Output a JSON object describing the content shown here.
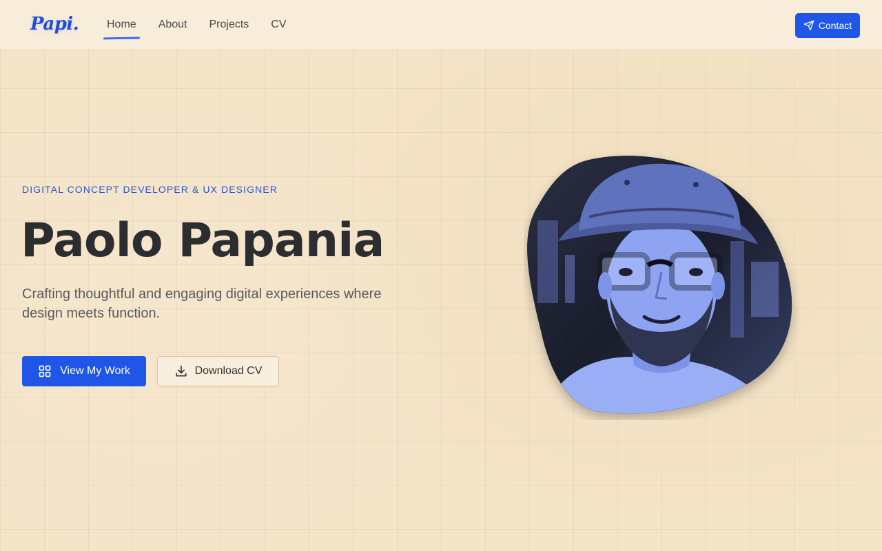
{
  "header": {
    "logo": "Papi.",
    "nav": [
      {
        "label": "Home"
      },
      {
        "label": "About"
      },
      {
        "label": "Projects"
      },
      {
        "label": "CV"
      }
    ],
    "contact_label": "Contact"
  },
  "hero": {
    "tagline": "DIGITAL CONCEPT DEVELOPER & UX DESIGNER",
    "name": "Paolo Papania",
    "subtitle": "Crafting thoughtful and engaging digital experiences where design meets function.",
    "primary_button": "View My Work",
    "secondary_button": "Download CV"
  },
  "colors": {
    "accent": "#1f56e8",
    "background": "#f4e4c8",
    "portrait_tint": "#8fa6f5"
  },
  "icons": {
    "contact": "send-icon",
    "primary": "grid-icon",
    "secondary": "download-icon"
  }
}
